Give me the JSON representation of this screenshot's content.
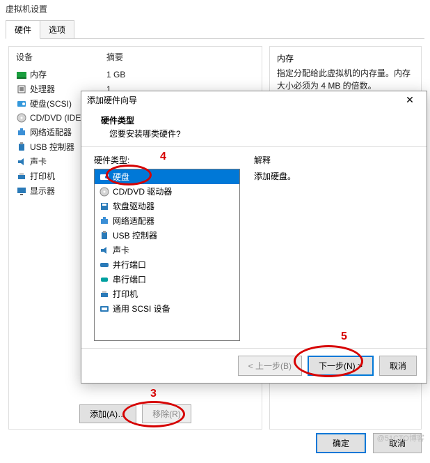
{
  "window_title": "虚拟机设置",
  "tabs": {
    "hardware": "硬件",
    "options": "选项"
  },
  "device_header": {
    "device": "设备",
    "summary": "摘要"
  },
  "devices": [
    {
      "icon": "memory-icon",
      "name": "内存",
      "summary": "1 GB"
    },
    {
      "icon": "cpu-icon",
      "name": "处理器",
      "summary": "1"
    },
    {
      "icon": "disk-icon",
      "name": "硬盘(SCSI)",
      "summary": ""
    },
    {
      "icon": "cd-icon",
      "name": "CD/DVD (IDE",
      "summary": ""
    },
    {
      "icon": "net-icon",
      "name": "网络适配器",
      "summary": ""
    },
    {
      "icon": "usb-icon",
      "name": "USB 控制器",
      "summary": ""
    },
    {
      "icon": "sound-icon",
      "name": "声卡",
      "summary": ""
    },
    {
      "icon": "printer-icon",
      "name": "打印机",
      "summary": ""
    },
    {
      "icon": "display-icon",
      "name": "显示器",
      "summary": ""
    }
  ],
  "device_buttons": {
    "add": "添加(A)…",
    "remove": "移除(R)"
  },
  "right_panel": {
    "header": "内存",
    "description": "指定分配给此虚拟机的内存量。内存大小必须为 4 MB 的倍数。"
  },
  "bottom_buttons": {
    "ok": "确定",
    "cancel": "取消"
  },
  "wizard": {
    "title": "添加硬件向导",
    "close": "✕",
    "heading": "硬件类型",
    "subheading": "您要安装哪类硬件?",
    "list_label": "硬件类型:",
    "items": [
      {
        "icon": "disk-icon",
        "label": "硬盘"
      },
      {
        "icon": "cd-icon",
        "label": "CD/DVD 驱动器"
      },
      {
        "icon": "floppy-icon",
        "label": "软盘驱动器"
      },
      {
        "icon": "net-icon",
        "label": "网络适配器"
      },
      {
        "icon": "usb-icon",
        "label": "USB 控制器"
      },
      {
        "icon": "sound-icon",
        "label": "声卡"
      },
      {
        "icon": "parallel-icon",
        "label": "并行端口"
      },
      {
        "icon": "serial-icon",
        "label": "串行端口"
      },
      {
        "icon": "printer-icon",
        "label": "打印机"
      },
      {
        "icon": "scsi-icon",
        "label": "通用 SCSI 设备"
      }
    ],
    "explain_label": "解释",
    "explain_text": "添加硬盘。",
    "back": "< 上一步(B)",
    "next": "下一步(N) >",
    "cancel": "取消"
  },
  "annotations": {
    "n3": "3",
    "n4": "4",
    "n5": "5"
  },
  "watermark": "@51CTO博客"
}
